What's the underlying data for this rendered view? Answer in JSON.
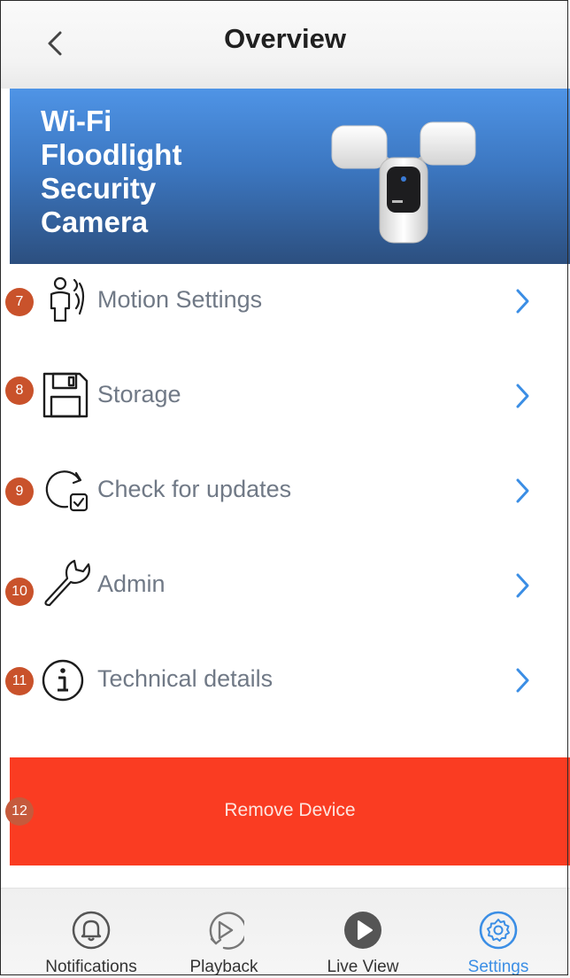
{
  "header": {
    "title": "Overview"
  },
  "banner": {
    "title": "Wi-Fi Floodlight Security Camera"
  },
  "menu": [
    {
      "badge": "7",
      "label": "Motion Settings",
      "icon": "motion-person-icon"
    },
    {
      "badge": "8",
      "label": "Storage",
      "icon": "floppy-disk-icon"
    },
    {
      "badge": "9",
      "label": "Check for updates",
      "icon": "update-check-icon"
    },
    {
      "badge": "10",
      "label": "Admin",
      "icon": "wrench-icon"
    },
    {
      "badge": "11",
      "label": "Technical details",
      "icon": "info-icon"
    }
  ],
  "remove": {
    "badge": "12",
    "label": "Remove Device"
  },
  "tabs": [
    {
      "label": "Notifications",
      "icon": "bell-icon"
    },
    {
      "label": "Playback",
      "icon": "playback-icon"
    },
    {
      "label": "Live View",
      "icon": "play-icon"
    },
    {
      "label": "Settings",
      "icon": "gear-icon"
    }
  ],
  "colors": {
    "accent": "#3b8ee5",
    "remove": "#fa3c22",
    "badge": "#c9522b",
    "banner_top": "#4f94e6",
    "banner_bottom": "#2c4f7f"
  }
}
